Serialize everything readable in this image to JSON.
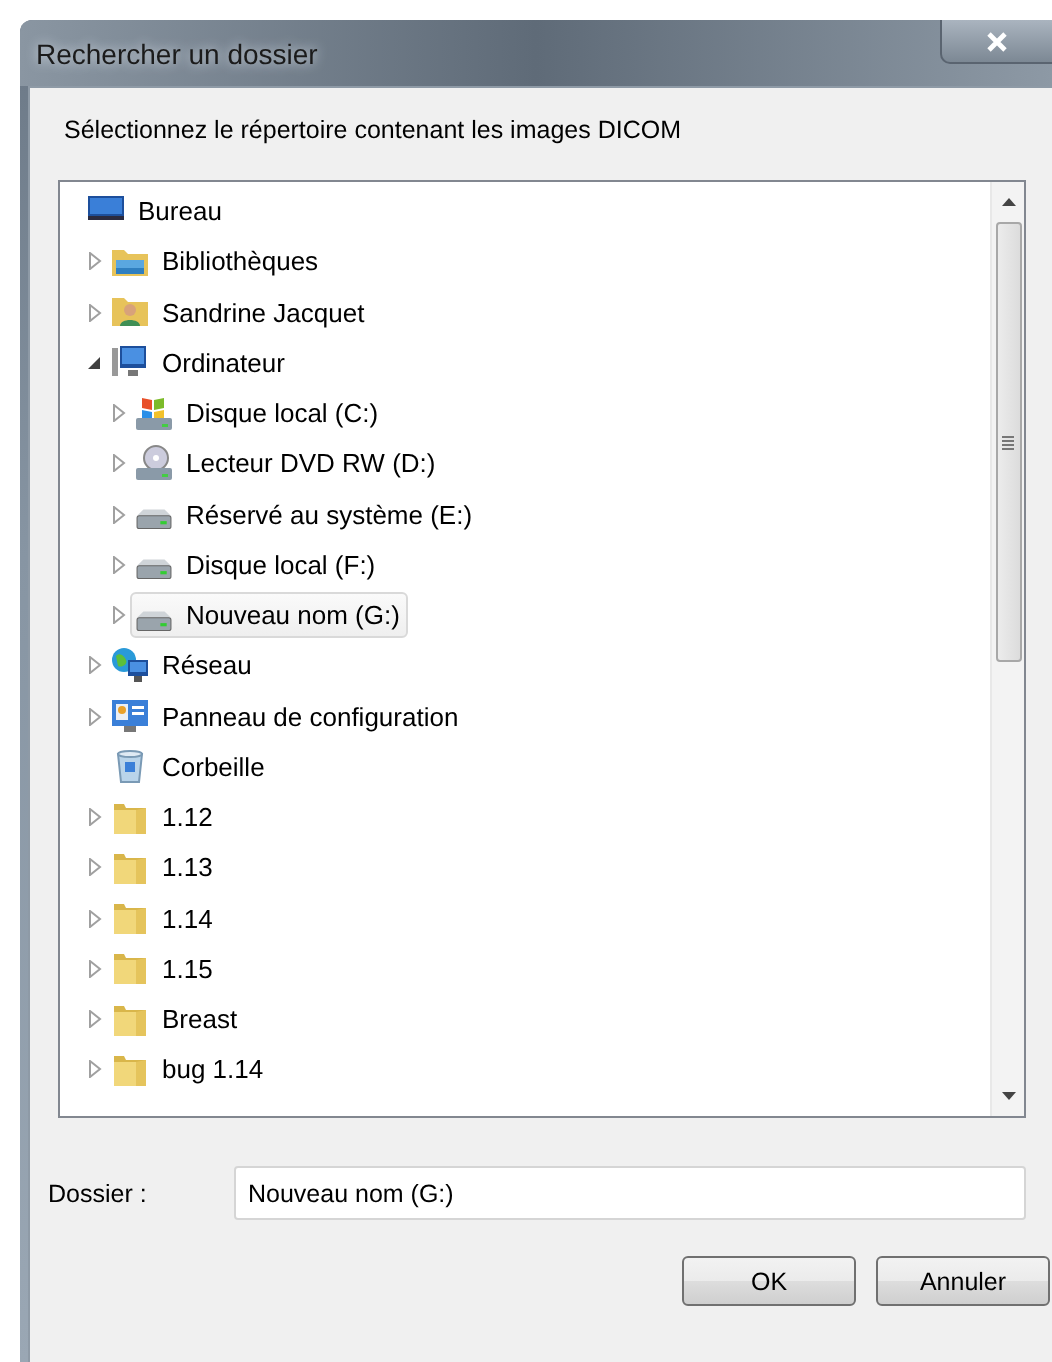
{
  "window": {
    "title": "Rechercher un dossier"
  },
  "instruction": "Sélectionnez le répertoire contenant les images DICOM",
  "tree": [
    {
      "label": "Bureau",
      "kind": "desktop",
      "expandable": false,
      "expanded": true,
      "selected": false,
      "children": [
        {
          "label": "Bibliothèques",
          "kind": "library",
          "expandable": true,
          "expanded": false,
          "selected": false
        },
        {
          "label": "Sandrine Jacquet",
          "kind": "user",
          "expandable": true,
          "expanded": false,
          "selected": false
        },
        {
          "label": "Ordinateur",
          "kind": "computer",
          "expandable": true,
          "expanded": true,
          "selected": false,
          "children": [
            {
              "label": "Disque local (C:)",
              "kind": "system-drive",
              "expandable": true,
              "expanded": false,
              "selected": false
            },
            {
              "label": "Lecteur DVD RW (D:)",
              "kind": "dvd-drive",
              "expandable": true,
              "expanded": false,
              "selected": false
            },
            {
              "label": "Réservé au système (E:)",
              "kind": "drive",
              "expandable": true,
              "expanded": false,
              "selected": false
            },
            {
              "label": "Disque local (F:)",
              "kind": "drive",
              "expandable": true,
              "expanded": false,
              "selected": false
            },
            {
              "label": "Nouveau nom (G:)",
              "kind": "drive",
              "expandable": true,
              "expanded": false,
              "selected": true
            }
          ]
        },
        {
          "label": "Réseau",
          "kind": "network",
          "expandable": true,
          "expanded": false,
          "selected": false
        },
        {
          "label": "Panneau de configuration",
          "kind": "control-panel",
          "expandable": true,
          "expanded": false,
          "selected": false
        },
        {
          "label": "Corbeille",
          "kind": "recycle-bin",
          "expandable": false,
          "expanded": false,
          "selected": false
        },
        {
          "label": "1.12",
          "kind": "folder",
          "expandable": true,
          "expanded": false,
          "selected": false
        },
        {
          "label": "1.13",
          "kind": "folder",
          "expandable": true,
          "expanded": false,
          "selected": false
        },
        {
          "label": "1.14",
          "kind": "folder",
          "expandable": true,
          "expanded": false,
          "selected": false
        },
        {
          "label": "1.15",
          "kind": "folder",
          "expandable": true,
          "expanded": false,
          "selected": false
        },
        {
          "label": "Breast",
          "kind": "folder",
          "expandable": true,
          "expanded": false,
          "selected": false
        },
        {
          "label": "bug 1.14",
          "kind": "folder",
          "expandable": true,
          "expanded": false,
          "selected": false
        }
      ]
    }
  ],
  "folder_field": {
    "label": "Dossier :",
    "value": "Nouveau nom (G:)"
  },
  "buttons": [
    "OK",
    "Annuler"
  ]
}
